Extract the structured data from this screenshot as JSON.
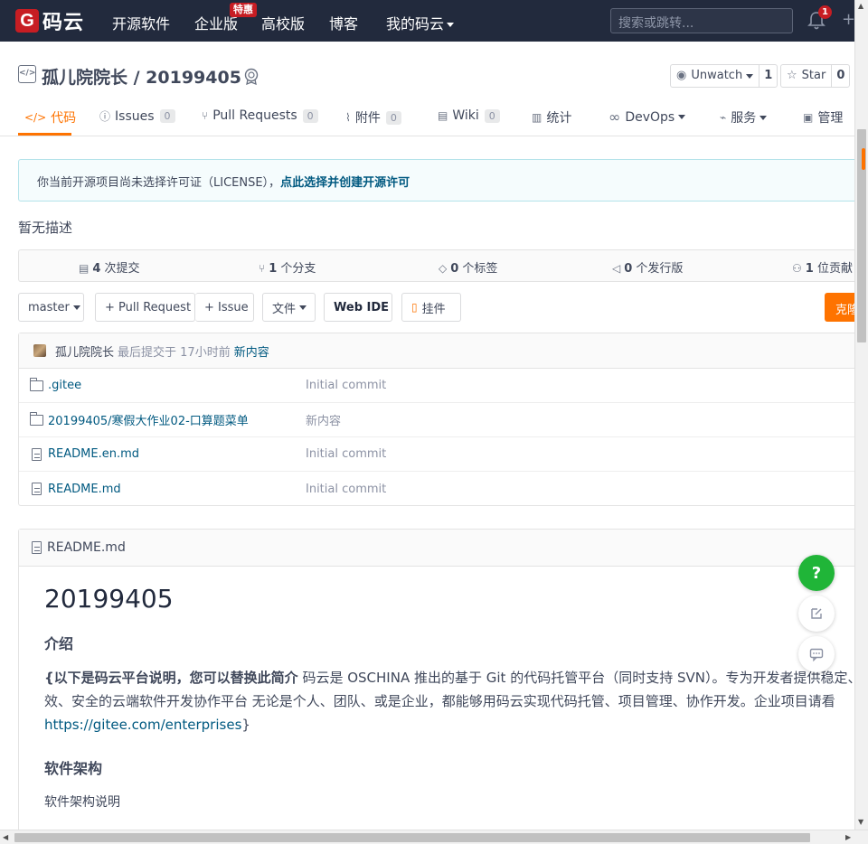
{
  "nav": {
    "logo_letter": "G",
    "logo_text": "码云",
    "items": [
      "开源软件",
      "企业版",
      "高校版",
      "博客",
      "我的码云"
    ],
    "badge": "特惠",
    "search_placeholder": "搜索或跳转...",
    "notification_count": "1",
    "plus": "+"
  },
  "project": {
    "icon": "</>",
    "title": "孤儿院院长 / 20199405",
    "watch_label": "Unwatch",
    "watch_count": "1",
    "star_label": "Star",
    "star_count": "0"
  },
  "tabs": [
    {
      "icon": "</>",
      "label": "代码",
      "count": ""
    },
    {
      "icon": "ⓘ",
      "label": "Issues",
      "count": "0"
    },
    {
      "icon": "⑂",
      "label": "Pull Requests",
      "count": "0"
    },
    {
      "icon": "⌇",
      "label": "附件",
      "count": "0"
    },
    {
      "icon": "▤",
      "label": "Wiki",
      "count": "0"
    },
    {
      "icon": "▥",
      "label": "统计",
      "count": ""
    },
    {
      "icon": "∞",
      "label": "DevOps",
      "count": ""
    },
    {
      "icon": "⌁",
      "label": "服务",
      "count": ""
    },
    {
      "icon": "▣",
      "label": "管理",
      "count": ""
    }
  ],
  "license_notice": {
    "text": "你当前开源项目尚未选择许可证（LICENSE），",
    "link": "点此选择并创建开源许可"
  },
  "description": "暂无描述",
  "stats": [
    {
      "icon": "▤",
      "count": "4",
      "label": "次提交"
    },
    {
      "icon": "⑂",
      "count": "1",
      "label": "个分支"
    },
    {
      "icon": "◇",
      "count": "0",
      "label": "个标签"
    },
    {
      "icon": "◁",
      "count": "0",
      "label": "个发行版"
    },
    {
      "icon": "⚇",
      "count": "1",
      "label": "位贡献"
    }
  ],
  "toolbar": {
    "branch": "master",
    "pull_request": "+ Pull Request",
    "issue": "+ Issue",
    "file": "文件",
    "web_ide": "Web IDE",
    "pendant": "挂件",
    "clone": "克隆"
  },
  "last_commit": {
    "author": "孤儿院院长",
    "time_text": "最后提交于 17小时前",
    "message": "新内容"
  },
  "files": [
    {
      "type": "folder",
      "name": ".gitee",
      "message": "Initial commit"
    },
    {
      "type": "folder",
      "name": "20199405/寒假大作业02-口算题菜单",
      "message": "新内容"
    },
    {
      "type": "file",
      "name": "README.en.md",
      "message": "Initial commit"
    },
    {
      "type": "file",
      "name": "README.md",
      "message": "Initial commit"
    }
  ],
  "readme": {
    "filename": "README.md",
    "h1": "20199405",
    "intro_heading": "介绍",
    "intro_bold": "{以下是码云平台说明，您可以替换此简介",
    "intro_text": " 码云是 OSCHINA 推出的基于 Git 的代码托管平台（同时支持 SVN）。专为开发者提供稳定、高效、安全的云端软件开发协作平台 无论是个人、团队、或是企业，都能够用码云实现代码托管、项目管理、协作开发。企业项目请看 ",
    "intro_link": "https://gitee.com/enterprises",
    "intro_end": "}",
    "arch_heading": "软件架构",
    "arch_text": "软件架构说明"
  },
  "float": {
    "help": "?"
  }
}
